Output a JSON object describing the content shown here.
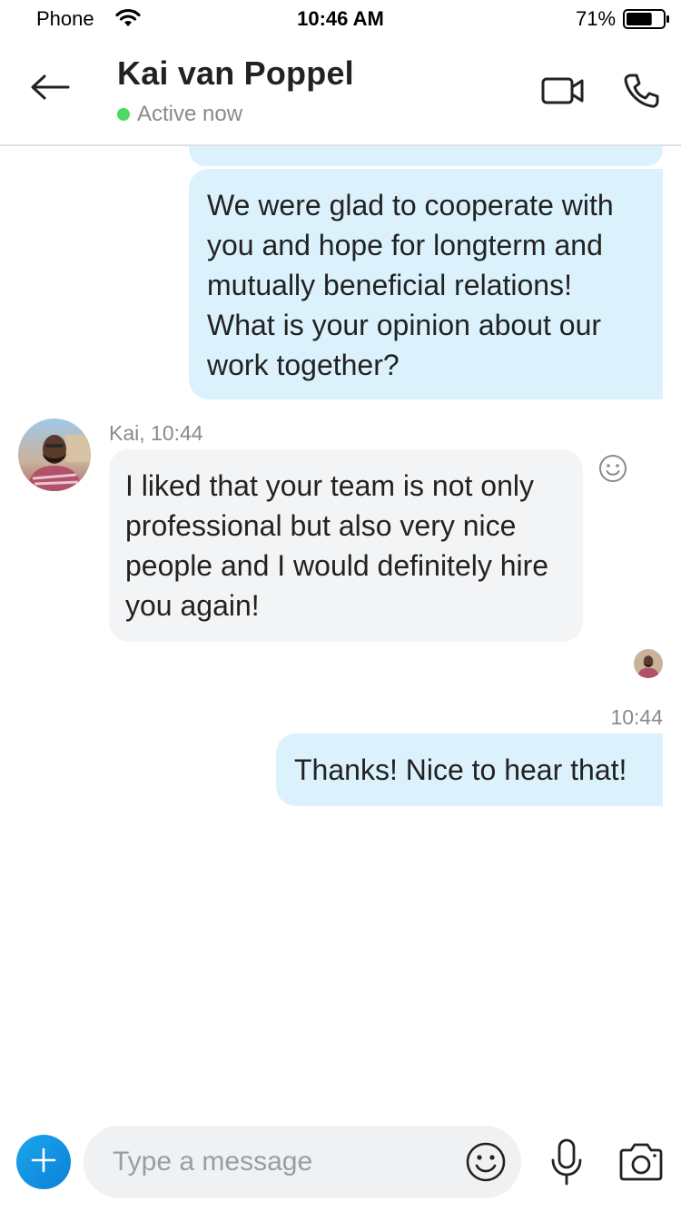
{
  "status_bar": {
    "carrier": "Phone",
    "time": "10:46 AM",
    "battery_percent": "71%",
    "battery_level": 0.71
  },
  "header": {
    "contact_name": "Kai van Poppel",
    "presence_text": "Active now",
    "presence_color": "#4cd964",
    "icons": [
      "back-arrow-icon",
      "video-call-icon",
      "phone-call-icon"
    ]
  },
  "messages": {
    "outgoing_1": {
      "text": "We were glad to cooperate with you and hope for longterm and mutually beneficial relations! What is your opinion about our work together?"
    },
    "incoming_1": {
      "sender_meta": "Kai, 10:44",
      "text": "I liked that your team is not only professional but also very nice people and I would definitely hire you again!"
    },
    "outgoing_2": {
      "time": "10:44",
      "text": "Thanks! Nice to hear that!"
    }
  },
  "composer": {
    "placeholder": "Type a message",
    "value": "",
    "icons": [
      "add-icon",
      "emoji-icon",
      "microphone-icon",
      "camera-icon"
    ]
  },
  "colors": {
    "outgoing_bubble": "#dbf2fd",
    "incoming_bubble": "#f2f4f6",
    "accent": "#0c7fd8"
  }
}
